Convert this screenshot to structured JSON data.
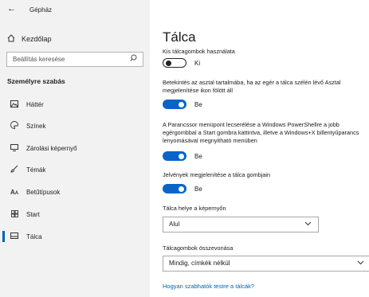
{
  "app": {
    "title": "Gépház"
  },
  "icons": {
    "back": "back-arrow-icon",
    "home": "home-icon",
    "search": "search-icon",
    "chevron": "chevron-down-icon"
  },
  "colors": {
    "accent": "#0a64c8",
    "link": "#0063b1",
    "sidebar_bg": "#f2f2f2"
  },
  "sidebar": {
    "home_label": "Kezdőlap",
    "search_placeholder": "Beállítás keresése",
    "section_title": "Személyre szabás",
    "items": [
      {
        "label": "Háttér",
        "icon": "image-icon"
      },
      {
        "label": "Színek",
        "icon": "palette-icon"
      },
      {
        "label": "Zárolási képernyő",
        "icon": "lock-screen-icon"
      },
      {
        "label": "Témák",
        "icon": "brush-icon"
      },
      {
        "label": "Betűtípusok",
        "icon": "font-icon"
      },
      {
        "label": "Start",
        "icon": "start-icon"
      },
      {
        "label": "Tálca",
        "icon": "taskbar-icon",
        "active": true
      }
    ]
  },
  "main": {
    "title": "Tálca",
    "small_buttons": {
      "label": "Kis tálcagombok használata",
      "state": "Ki",
      "on": false
    },
    "peek": {
      "label": "Betekintés az asztal tartalmába, ha az egér a tálca szélén lévő Asztal megjelenítése ikon fölött áll",
      "state": "Be",
      "on": true
    },
    "powershell": {
      "label": "A Parancssor menüpont lecserélése a Windows PowerShellre a jobb egérgombbal a Start gombra kattintva, illetve a Windows+X billentyűparancs lenyomásával megnyitható menüben",
      "state": "Be",
      "on": true
    },
    "badges": {
      "label": "Jelvények megjelenítése a tálca gombjain",
      "state": "Be",
      "on": true
    },
    "location": {
      "label": "Tálca helye a képernyőn",
      "value": "Alul"
    },
    "combine": {
      "label": "Tálcagombok összevonása",
      "value": "Mindig, címkék nélkül"
    },
    "help_link": "Hogyan szabhatók testre a tálcák?"
  }
}
